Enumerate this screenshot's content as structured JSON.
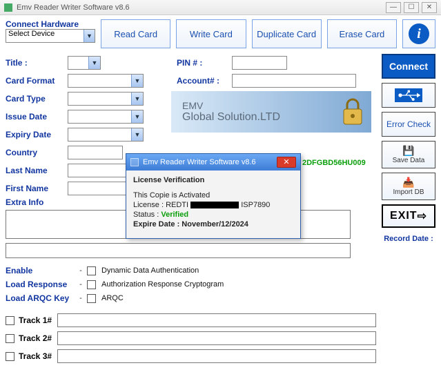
{
  "window": {
    "title": "Emv Reader Writer Software v8.6"
  },
  "connectHardware": {
    "label": "Connect Hardware",
    "selected": "Select Device"
  },
  "topButtons": {
    "read": "Read Card",
    "write": "Write Card",
    "duplicate": "Duplicate Card",
    "erase": "Erase Card"
  },
  "side": {
    "connect": "Connect",
    "errorCheck": "Error Check",
    "saveData": "Save Data",
    "importDb": "Import DB",
    "exit": "EXIT",
    "recordDate": "Record Date :"
  },
  "form": {
    "titleLabel": "Title :",
    "pinLabel": "PIN # :",
    "cardFormatLabel": "Card Format",
    "accountLabel": "Account# :",
    "cardTypeLabel": "Card Type",
    "issueDateLabel": "Issue Date",
    "expiryDateLabel": "Expiry Date",
    "countryLabel": "Country",
    "lastNameLabel": "Last Name",
    "firstNameLabel": "First Name",
    "extraInfoLabel": "Extra Info"
  },
  "banner": {
    "line1": "EMV",
    "line2": "Global Solution.LTD"
  },
  "greenCode": "2DFGBD56HU009",
  "checks": {
    "enableLabel": "Enable",
    "dynamic": "Dynamic Data Authentication",
    "loadResponseLabel": "Load Response",
    "arc": "Authorization Response Cryptogram",
    "loadArqcLabel": "Load ARQC Key",
    "arqc": "ARQC"
  },
  "tracks": {
    "t1": "Track 1#",
    "t2": "Track 2#",
    "t3": "Track 3#"
  },
  "dialog": {
    "title": "Emv Reader Writer Software v8.6",
    "header": "License Verification",
    "activated": "This Copie is Activated",
    "licensePrefix": "License : REDTI",
    "licenseSuffix": " ISP7890",
    "statusLabel": "Status : ",
    "statusValue": "Verified",
    "expire": "Expire Date :  November/12/2024"
  }
}
